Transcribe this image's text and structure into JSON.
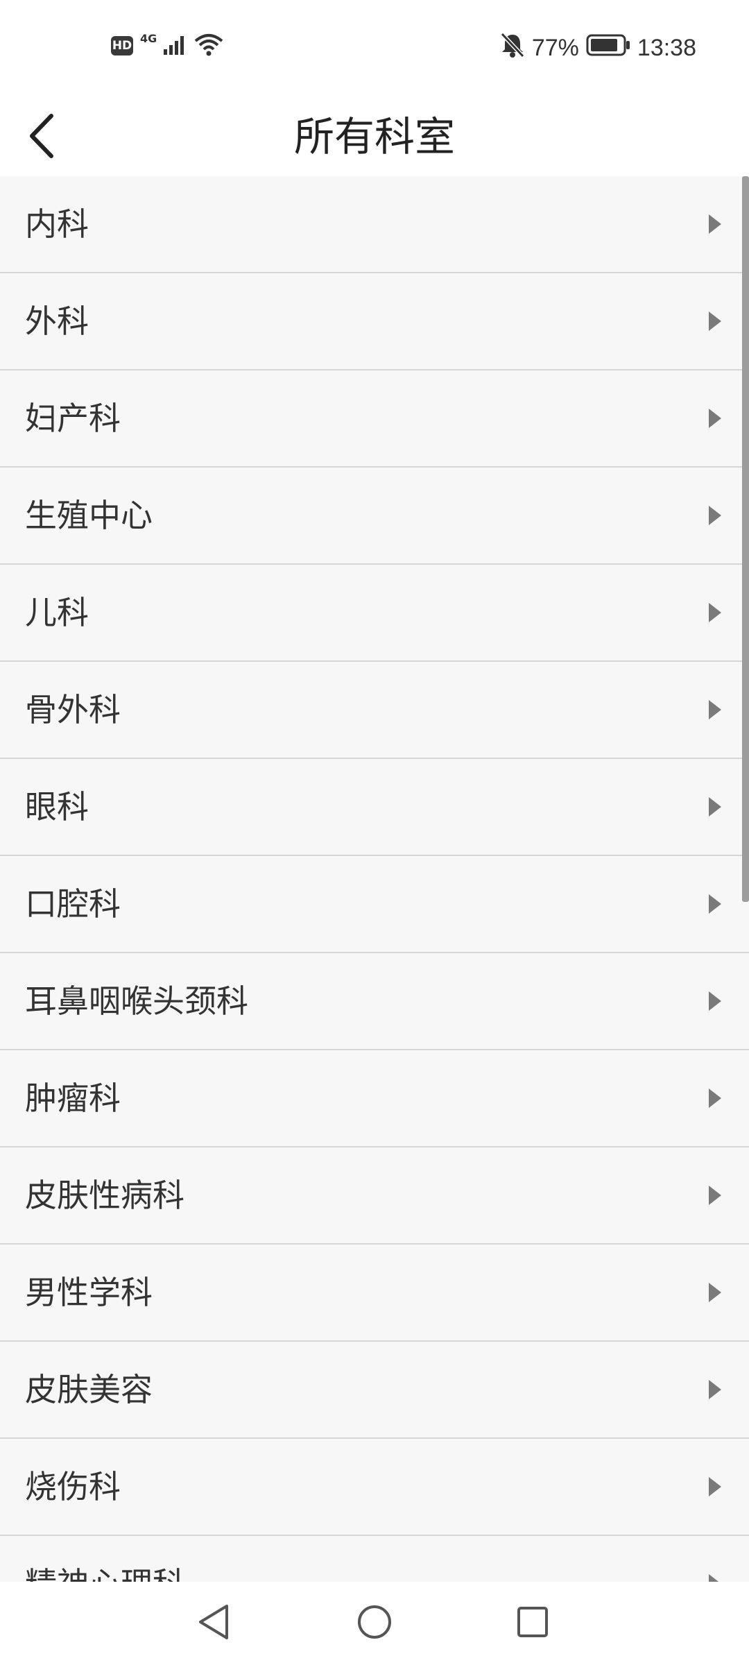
{
  "status_bar": {
    "hd_label": "HD",
    "network_type": "4G",
    "battery_percent": "77%",
    "time": "13:38",
    "icons": [
      "hd-icon",
      "signal-icon",
      "wifi-icon",
      "bell-muted-icon",
      "battery-icon"
    ]
  },
  "header": {
    "title": "所有科室",
    "back_icon": "chevron-left-icon"
  },
  "departments": [
    {
      "label": "内科"
    },
    {
      "label": "外科"
    },
    {
      "label": "妇产科"
    },
    {
      "label": "生殖中心"
    },
    {
      "label": "儿科"
    },
    {
      "label": "骨外科"
    },
    {
      "label": "眼科"
    },
    {
      "label": "口腔科"
    },
    {
      "label": "耳鼻咽喉头颈科"
    },
    {
      "label": "肿瘤科"
    },
    {
      "label": "皮肤性病科"
    },
    {
      "label": "男性学科"
    },
    {
      "label": "皮肤美容"
    },
    {
      "label": "烧伤科"
    },
    {
      "label": "精神心理科"
    }
  ],
  "nav_bar": {
    "icons": [
      "back-triangle-icon",
      "home-circle-icon",
      "recents-square-icon"
    ]
  },
  "colors": {
    "list_background": "#f7f7f7",
    "divider": "#d6d6d6",
    "text": "#333333",
    "arrow": "#7a7a7a"
  }
}
